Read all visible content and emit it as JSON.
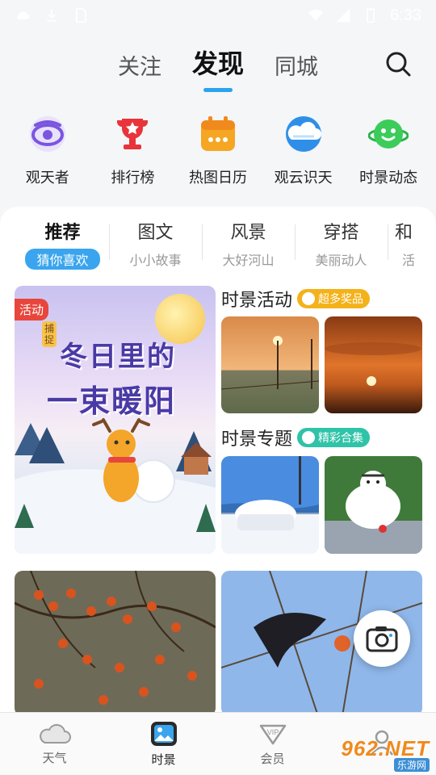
{
  "status_bar": {
    "time": "6:33"
  },
  "top_tabs": [
    {
      "label": "关注",
      "active": false
    },
    {
      "label": "发现",
      "active": true
    },
    {
      "label": "同城",
      "active": false
    }
  ],
  "quick_entries": [
    {
      "label": "观天者",
      "icon": "eye-icon"
    },
    {
      "label": "排行榜",
      "icon": "trophy-icon"
    },
    {
      "label": "热图日历",
      "icon": "calendar-icon"
    },
    {
      "label": "观云识天",
      "icon": "cloud-icon"
    },
    {
      "label": "时景动态",
      "icon": "smiley-planet-icon"
    }
  ],
  "categories": [
    {
      "name": "推荐",
      "sub": "猜你喜欢",
      "active": true
    },
    {
      "name": "图文",
      "sub": "小小故事",
      "active": false
    },
    {
      "name": "风景",
      "sub": "大好河山",
      "active": false
    },
    {
      "name": "穿搭",
      "sub": "美丽动人",
      "active": false
    },
    {
      "name": "和",
      "sub": "活",
      "active": false
    }
  ],
  "promo": {
    "badge": "活动",
    "tag": "捕捉",
    "title_line1": "冬日里的",
    "title_line2": "一束暖阳"
  },
  "sections": {
    "activity": {
      "title": "时景活动",
      "tag": "超多奖品",
      "tag_color": "#f4b21a"
    },
    "topic": {
      "title": "时景专题",
      "tag": "精彩合集",
      "tag_color": "#2fc3a8"
    }
  },
  "bottom_nav": [
    {
      "label": "天气",
      "icon": "cloud-icon",
      "active": false
    },
    {
      "label": "时景",
      "icon": "photo-icon",
      "active": true
    },
    {
      "label": "会员",
      "icon": "vip-icon",
      "active": false
    },
    {
      "label": "",
      "icon": "person-icon",
      "active": false
    }
  ],
  "watermark": {
    "big": "962.NET",
    "small": "乐游网"
  },
  "colors": {
    "accent": "#2aa3ef",
    "badge_red": "#e8463c"
  }
}
